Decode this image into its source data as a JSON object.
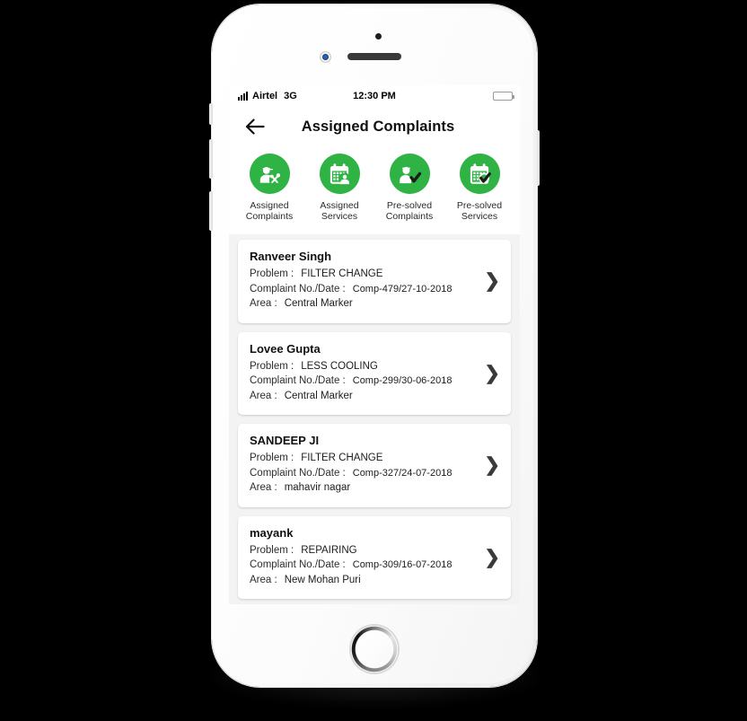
{
  "device": {
    "home_button": "home-button",
    "front_camera": "front-camera",
    "speaker": "earpiece-speaker",
    "proximity_sensor": "proximity-sensor"
  },
  "statusbar": {
    "signal": "signal-bars-icon",
    "carrier": "Airtel",
    "network": "3G",
    "time": "12:30 PM",
    "battery": "battery-icon"
  },
  "navbar": {
    "back": "←",
    "title": "Assigned Complaints"
  },
  "shortcuts": [
    {
      "icon": "worker-tools-icon",
      "label": "Assigned\nComplaints"
    },
    {
      "icon": "calendar-person-icon",
      "label": "Assigned\nServices"
    },
    {
      "icon": "worker-check-icon",
      "label": "Pre-solved\nComplaints"
    },
    {
      "icon": "calendar-check-icon",
      "label": "Pre-solved\nServices"
    }
  ],
  "labels": {
    "problem": "Problem :",
    "complaint": "Complaint No./Date :",
    "area": "Area :",
    "chevron": "❯"
  },
  "complaints": [
    {
      "name": "Ranveer Singh",
      "problem": "FILTER CHANGE",
      "complaint_no_date": "Comp-479/27-10-2018",
      "area": "Central Marker"
    },
    {
      "name": "Lovee Gupta",
      "problem": "LESS COOLING",
      "complaint_no_date": "Comp-299/30-06-2018",
      "area": "Central Marker"
    },
    {
      "name": "SANDEEP JI",
      "problem": "FILTER CHANGE",
      "complaint_no_date": "Comp-327/24-07-2018",
      "area": "mahavir nagar"
    },
    {
      "name": "mayank",
      "problem": "REPAIRING",
      "complaint_no_date": "Comp-309/16-07-2018",
      "area": "New Mohan Puri"
    }
  ],
  "colors": {
    "accent_green": "#2fb344",
    "screen_bg": "#f3f3f3",
    "card_bg": "#ffffff",
    "text": "#1c1c1c"
  }
}
